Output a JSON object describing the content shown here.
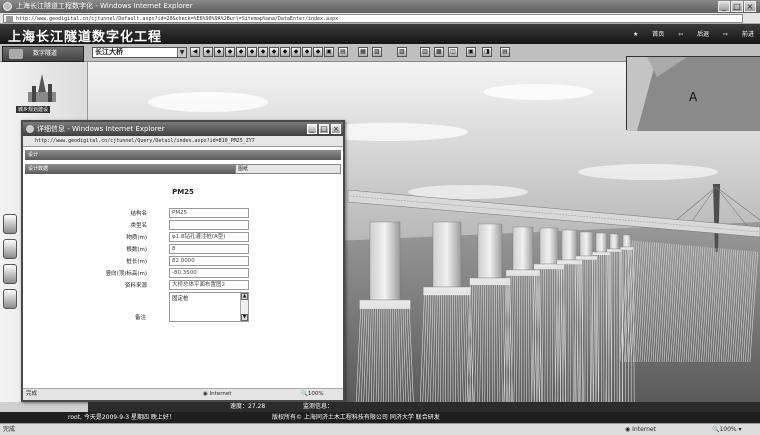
{
  "window": {
    "title": "上海长江隧道工程数字化 - Windows Internet Explorer",
    "url": "http://www.geodigital.cn/cjtunnel/Default.aspx?id=20&check=%E6%90%9A%2Burl=Sitemap%ana/DataEnter/index.aspx"
  },
  "app": {
    "title": "上海长江隧道数字化工程",
    "nav": {
      "home": "首页",
      "back": "后退",
      "forward": "前进"
    }
  },
  "sidebar": {
    "top_button": "数字隧道",
    "logo_label": "城乡规划建设"
  },
  "toolbar": {
    "combo_value": "长江大桥",
    "icons": [
      "play-reverse",
      "stop",
      "jump",
      "hand",
      "rotate",
      "zoom-in",
      "zoom-out",
      "measure",
      "pan",
      "layers",
      "grid",
      "select",
      "info",
      "legend",
      "measure-area",
      "screenshot",
      "print",
      "map",
      "help",
      "text",
      "settings",
      "map-view",
      "fly"
    ]
  },
  "scene": {
    "thumb_label": "A"
  },
  "popup": {
    "title": "详细信息 - Windows Internet Explorer",
    "url": "http://www.geodigital.cn/cjtunnel/Query/Detail/index.aspx?id=810_PM25_ZY7",
    "bar1_label": "设计",
    "tab_design": "设计数据",
    "tab_drawing": "图纸",
    "record_title": "PM25",
    "fields": [
      {
        "label": "结构名",
        "value": "PM25"
      },
      {
        "label": "类型名",
        "value": ""
      },
      {
        "label": "物质(m)",
        "value": "φ1.8钻孔灌注桩(A型)"
      },
      {
        "label": "根数(m)",
        "value": "8"
      },
      {
        "label": "桩长(m)",
        "value": "82.0000"
      },
      {
        "label": "竖向(顶)标高(m)",
        "value": "-80.3500"
      },
      {
        "label": "资料来源",
        "value": "大桥总体平面布置图2"
      }
    ],
    "notes_label": "备注",
    "notes_value": "固定桩",
    "status": {
      "left": "完成",
      "zone": "Internet",
      "zoom": "100%"
    }
  },
  "infostrip": {
    "speed": "速度：27.28",
    "monitor": "监测信息："
  },
  "footer": {
    "greeting": "root, 今天是2009-9-3 星期四 晚上好！",
    "copyright": "版权所有© 上海同济土木工程科技有限公司  同济大学  联合研发"
  },
  "iestatus": {
    "left": "完成",
    "zone": "Internet",
    "zoom": "100%"
  }
}
